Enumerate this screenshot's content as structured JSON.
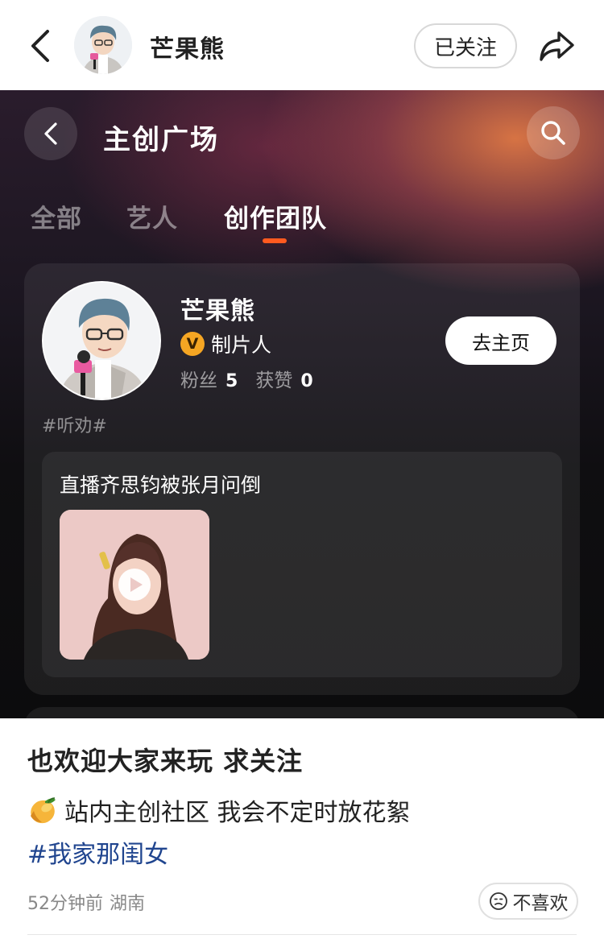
{
  "header": {
    "name": "芒果熊",
    "follow_label": "已关注"
  },
  "panel": {
    "title": "主创广场",
    "tabs": [
      {
        "label": "全部",
        "active": false
      },
      {
        "label": "艺人",
        "active": false
      },
      {
        "label": "创作团队",
        "active": true
      }
    ],
    "accent_color": "#ff5a1f",
    "card": {
      "name": "芒果熊",
      "badge": "V",
      "role": "制片人",
      "fans_label": "粉丝",
      "fans_count": "5",
      "likes_label": "获赞",
      "likes_count": "0",
      "home_button": "去主页",
      "tag": "#听劝#",
      "post": {
        "title": "直播齐思钧被张月问倒"
      }
    }
  },
  "post": {
    "headline": "也欢迎大家来玩 求关注",
    "line": "站内主创社区 我会不定时放花絮",
    "hashtag": "#我家那闺女",
    "time": "52分钟前",
    "location": "湖南",
    "dislike_label": "不喜欢"
  },
  "icons": {
    "back": "chevron-left-icon",
    "share": "share-arrow-icon",
    "search": "search-icon",
    "play": "play-icon",
    "mango": "mango-emoji-icon",
    "dislike": "frown-face-icon"
  }
}
